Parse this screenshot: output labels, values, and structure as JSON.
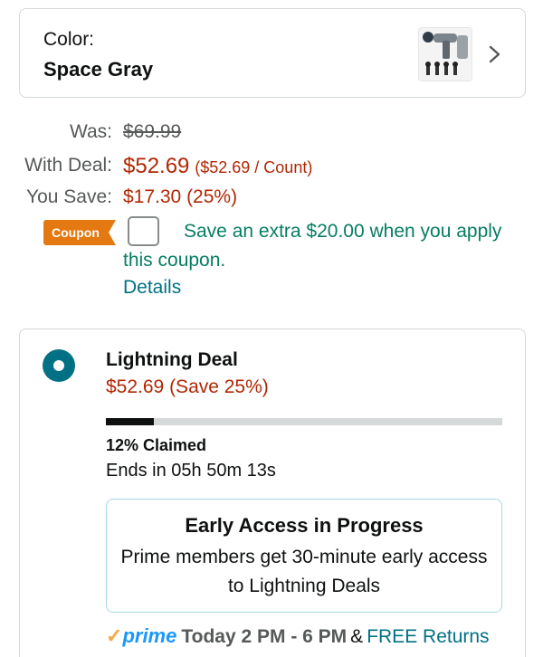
{
  "color_selector": {
    "label": "Color:",
    "value": "Space Gray",
    "thumbnail_icon": "massage-gun-product-thumbnail",
    "chevron_icon": "chevron-right-icon"
  },
  "pricing": {
    "was_label": "Was:",
    "was_price": "$69.99",
    "deal_label": "With Deal:",
    "deal_price": "$52.69",
    "per_count": "($52.69 / Count)",
    "save_label": "You Save:",
    "save_value": "$17.30 (25%)"
  },
  "coupon": {
    "badge": "Coupon",
    "checked": false,
    "text": "Save an extra $20.00 when you apply this coupon.",
    "details_link": "Details"
  },
  "lightning_deal": {
    "selected": true,
    "title": "Lightning Deal",
    "price_text": "$52.69 (Save 25%)",
    "claimed_percent": 12,
    "claimed_text": "12% Claimed",
    "ends_text": "Ends in 05h 50m 13s",
    "early_access": {
      "title": "Early Access in Progress",
      "body": "Prime members get 30-minute early access to Lightning Deals"
    },
    "delivery": {
      "prime_check": "✓",
      "prime_word": "prime",
      "window": "Today 2 PM - 6 PM",
      "ampersand": "&",
      "returns_link": "FREE Returns"
    }
  },
  "colors": {
    "price_red": "#b12704",
    "link_teal": "#007185",
    "coupon_green": "#067d62",
    "coupon_orange": "#e47911",
    "prime_blue": "#1a98ff"
  }
}
